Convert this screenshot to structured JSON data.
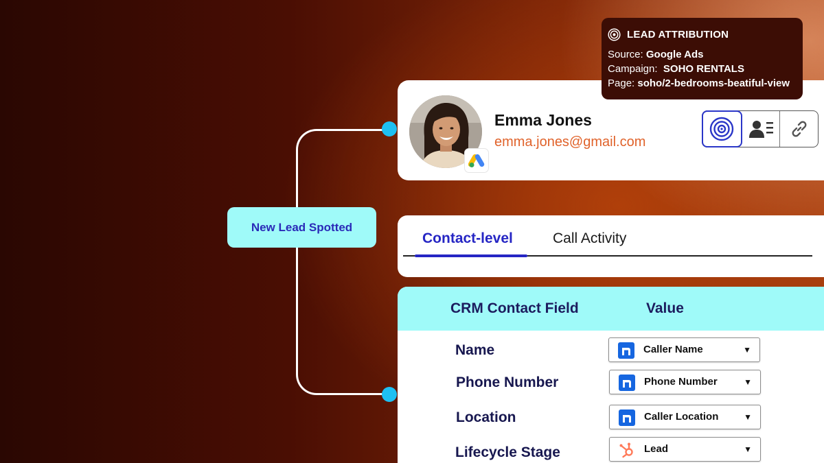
{
  "flow": {
    "trigger_label": "New Lead Spotted"
  },
  "contact": {
    "name": "Emma Jones",
    "email": "emma.jones@gmail.com",
    "source_badge_icon": "google-ads-icon",
    "actions": [
      {
        "icon": "attribution-target-icon",
        "active": true
      },
      {
        "icon": "contact-card-icon",
        "active": false
      },
      {
        "icon": "link-icon",
        "active": false
      }
    ]
  },
  "attribution": {
    "title": "LEAD ATTRIBUTION",
    "source_label": "Source:",
    "source_value": "Google Ads",
    "campaign_label": "Campaign:",
    "campaign_value": "SOHO RENTALS",
    "page_label": "Page:",
    "page_value": "soho/2-bedrooms-beatiful-view"
  },
  "tabs": [
    {
      "label": "Contact-level",
      "active": true
    },
    {
      "label": "Call Activity",
      "active": false
    }
  ],
  "crm": {
    "header_field": "CRM Contact Field",
    "header_value": "Value",
    "rows": [
      {
        "label": "Name",
        "value": "Caller Name",
        "icon": "nimbata-icon"
      },
      {
        "label": "Phone Number",
        "value": "Phone Number",
        "icon": "nimbata-icon"
      },
      {
        "label": "Location",
        "value": "Caller Location",
        "icon": "nimbata-icon"
      },
      {
        "label": "Lifecycle Stage",
        "value": "Lead",
        "icon": "hubspot-icon"
      }
    ]
  },
  "colors": {
    "accent_blue": "#2626c4",
    "cyan": "#9ffaf9",
    "email_orange": "#e0622a",
    "connector_dot": "#1ec0f2",
    "tooltip_bg": "#3c0d05"
  }
}
